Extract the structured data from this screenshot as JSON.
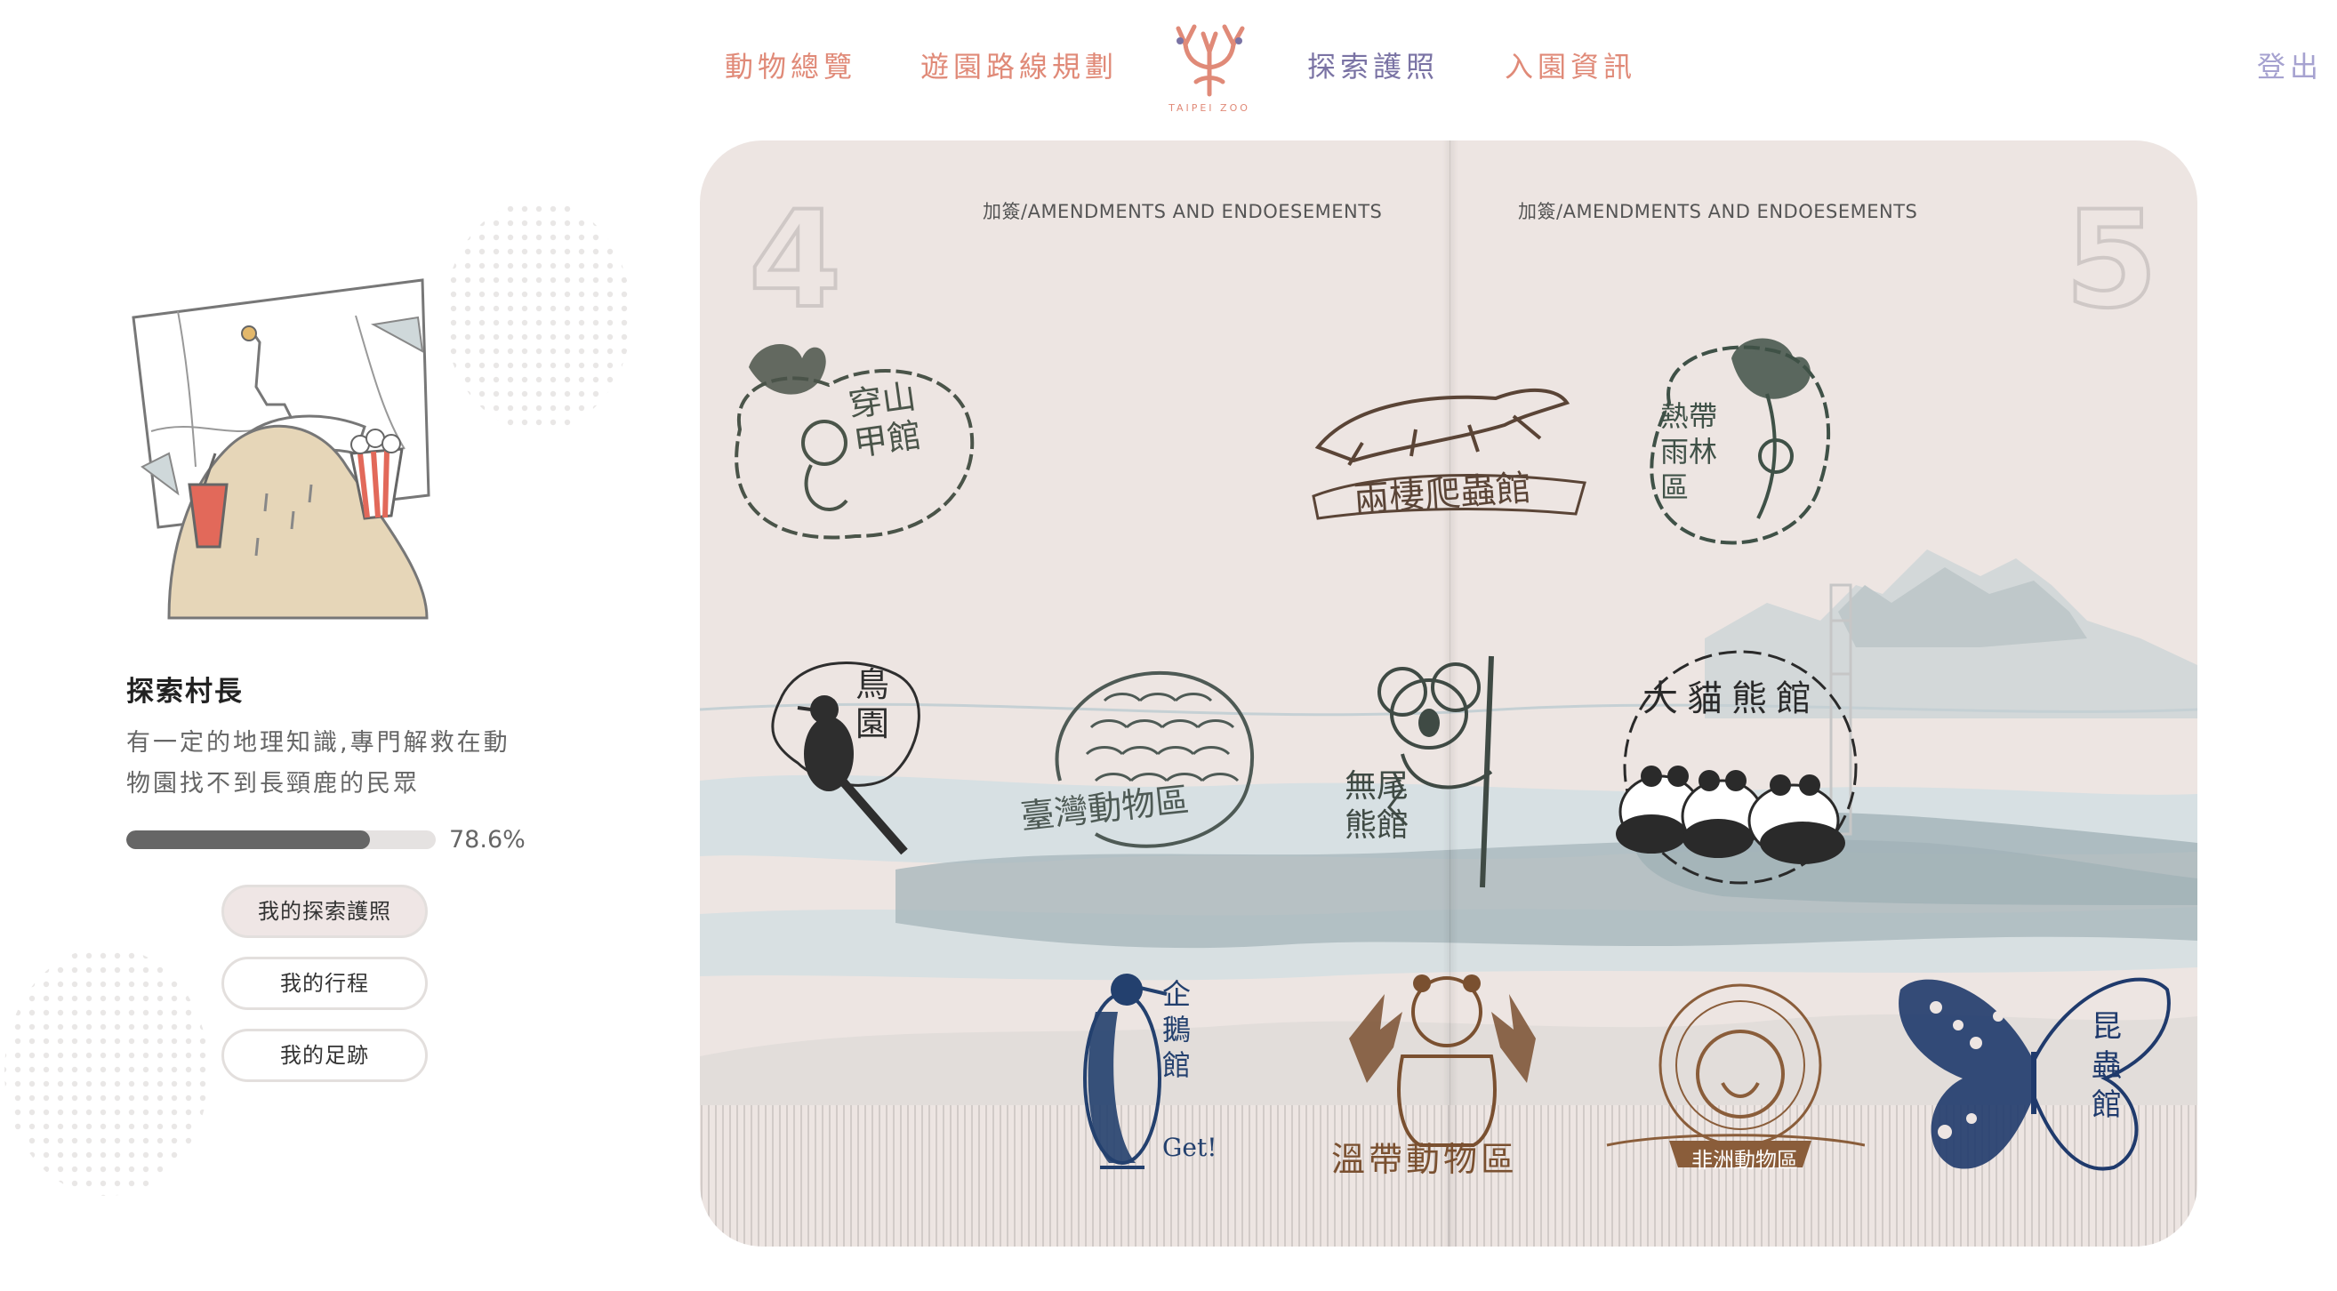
{
  "nav": {
    "items": [
      "動物總覽",
      "遊園路線規劃",
      "探索護照",
      "入園資訊"
    ],
    "logo_text": "TAIPEI ZOO",
    "logout": "登出"
  },
  "profile": {
    "title": "探索村長",
    "description": "有一定的地理知識,專門解救在動物園找不到長頸鹿的民眾",
    "progress": 78.6,
    "progress_label": "78.6%",
    "buttons": [
      "我的探索護照",
      "我的行程",
      "我的足跡"
    ]
  },
  "passport": {
    "left_page_number": "4",
    "right_page_number": "5",
    "left_header": "加簽/AMENDMENTS AND ENDOESEMENTS",
    "right_header": "加簽/AMENDMENTS AND ENDOESEMENTS",
    "stamps": [
      {
        "label": "穿山甲館",
        "color": "#4a5449"
      },
      {
        "label": "兩棲爬蟲館",
        "color": "#5a4436"
      },
      {
        "label": "熱帶雨林區",
        "color": "#3f5147"
      },
      {
        "label": "鳥園",
        "color": "#2e2e2e"
      },
      {
        "label": "臺灣動物區",
        "color": "#4e5a55"
      },
      {
        "label": "無尾熊館",
        "color": "#3f4a44"
      },
      {
        "label": "大貓熊館",
        "color": "#2a2a2a"
      },
      {
        "label": "企鵝館",
        "color": "#23406e"
      },
      {
        "label": "Get!",
        "color": "#23406e"
      },
      {
        "label": "溫帶動物區",
        "color": "#7a5030"
      },
      {
        "label": "非洲動物區",
        "color": "#8a5d3a"
      },
      {
        "label": "昆蟲館",
        "color": "#1f3a6c"
      }
    ]
  },
  "colors": {
    "nav_accent": "#e08a78",
    "nav_active": "#7a73a4",
    "logout": "#a6a2d0",
    "passport_bg": "#ede5e2",
    "progress_fill": "#666666"
  }
}
